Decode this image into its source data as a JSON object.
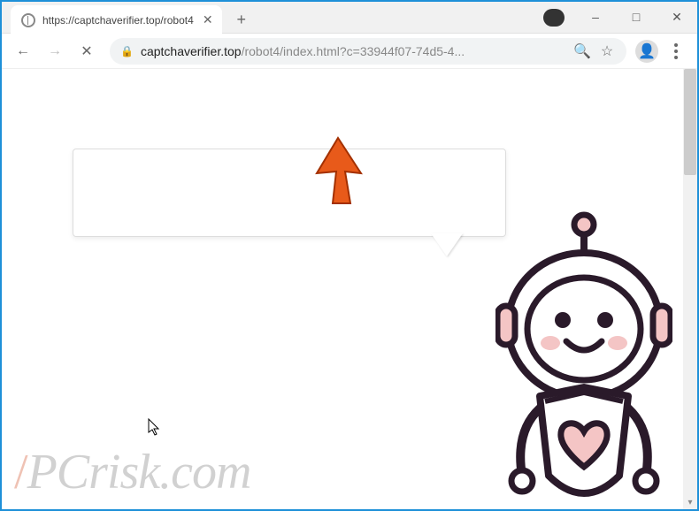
{
  "window": {
    "minimize": "–",
    "maximize": "□",
    "close": "✕"
  },
  "tab": {
    "title": "https://captchaverifier.top/robot4",
    "close": "✕"
  },
  "new_tab": "+",
  "nav": {
    "back": "←",
    "forward": "→",
    "reload": "✕"
  },
  "omnibox": {
    "lock": "🔒",
    "domain": "captchaverifier.top",
    "path": "/robot4/index.html?c=33944f07-74d5-4...",
    "search": "🔍",
    "star": "☆"
  },
  "profile": "👤",
  "watermark": {
    "pc": "PC",
    "risk": "risk",
    "dotcom": ".com"
  },
  "speech_text": "",
  "colors": {
    "accent": "#1e90d8",
    "pointer": "#e85a1a",
    "robot_outline": "#2a1a2a",
    "robot_fill": "#ffffff",
    "robot_accent": "#f4c5c5"
  }
}
